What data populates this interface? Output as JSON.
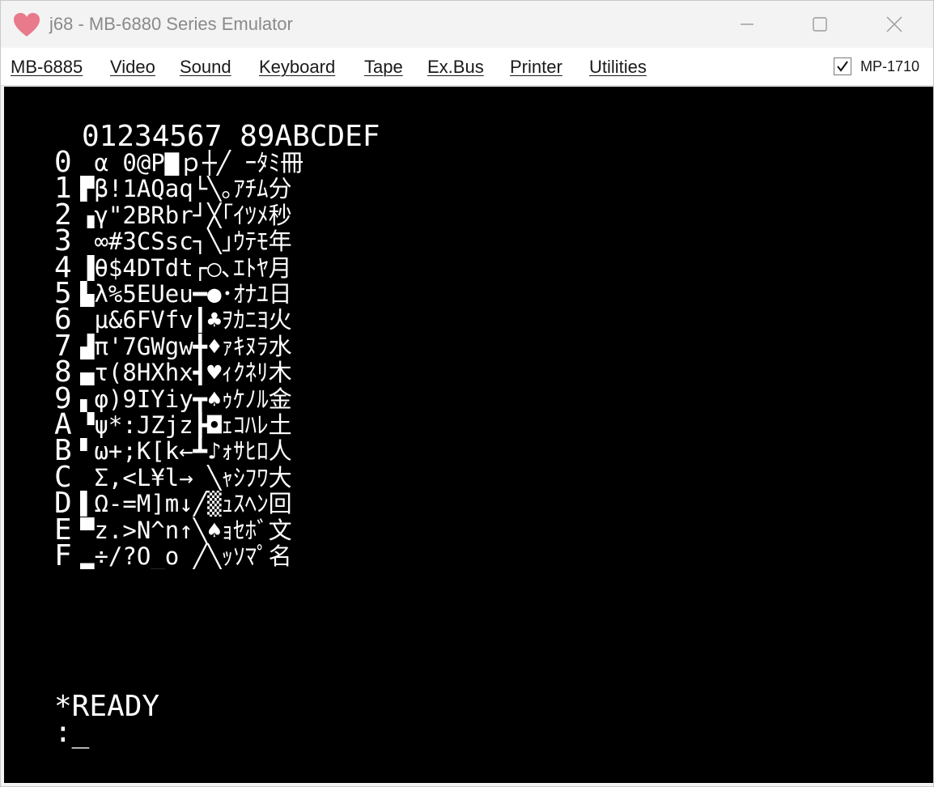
{
  "window": {
    "title": "j68 - MB-6880 Series Emulator"
  },
  "menu": {
    "items": [
      "MB-6885",
      "Video",
      "Sound",
      "Keyboard",
      "Tape",
      "Ex.Bus",
      "Printer",
      "Utilities"
    ],
    "checkbox_label": "MP-1710",
    "checkbox_checked": true
  },
  "screen": {
    "header": "01234567 89ABCDEF",
    "row_labels": [
      "0",
      "1",
      "2",
      "3",
      "4",
      "5",
      "6",
      "7",
      "8",
      "9",
      "A",
      "B",
      "C",
      "D",
      "E",
      "F"
    ],
    "rows": [
      " α 0@P▇ｐ┼╱ ｰﾀﾐ冊",
      "▛β!1AQaq└╲｡ｱﾁﾑ分",
      "▗γ\"2BRbr┘╳｢ｲﾂﾒ秒",
      " ∞#3CSsc┐╲｣ｳﾃﾓ年",
      "▐θ$4DTdt┌○､ｴﾄﾔ月",
      "▙λ%5EUeu━●･ｵﾅﾕ日",
      " μ&6FVfv┃♣ｦｶﾆﾖ火",
      "▟π'7GWgw╋♦ｧｷﾇﾗ水",
      "▄τ(8HXhx┫♥ｨｸﾈﾘ木",
      "▖φ)9IYiy┳♠ｩｹﾉﾙ金",
      "▝ψ*:JZjz┣◘ｪｺﾊﾚ土",
      "▘ω+;K[k←┻♪ｫｻﾋﾛ人",
      " Σ,<L¥l→ ╲ｬｼﾌﾜ大",
      "▌Ω-=M]m↓╱▒ｭｽﾍﾝ回",
      "▀z.>N^n↑╲♠ｮｾﾎﾞ文",
      "▂÷/?O_o ╱╲ｯｿﾏﾟ名"
    ],
    "prompt_line1": "*READY",
    "prompt_line2": ":_"
  },
  "colors": {
    "screen_bg": "#000000",
    "screen_fg": "#ffffff",
    "icon_heart": "#e87a8c"
  },
  "icons": {
    "app": "heart-icon",
    "minimize": "minimize-icon",
    "maximize": "maximize-icon",
    "close": "close-icon",
    "check": "check-icon"
  }
}
